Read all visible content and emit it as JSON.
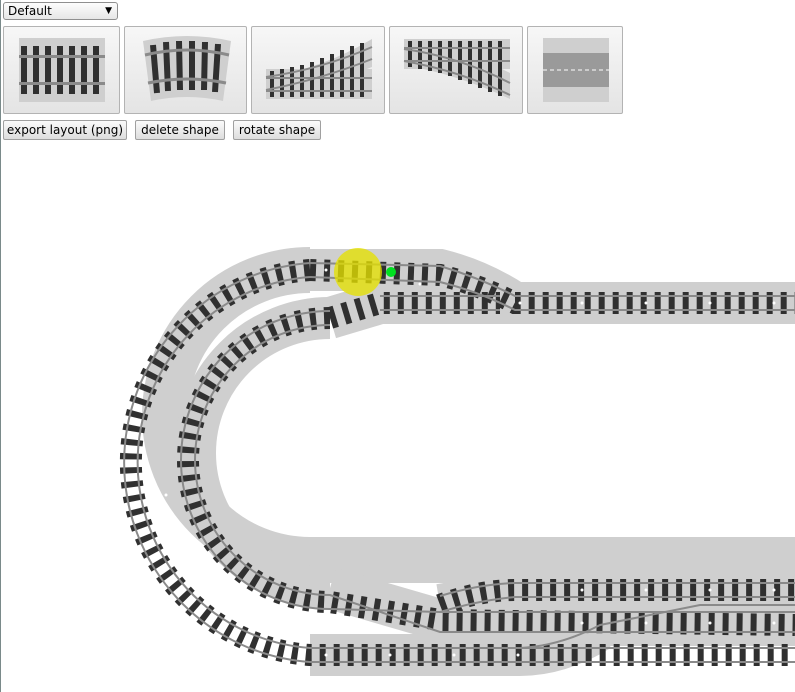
{
  "toolbar": {
    "layout_select": {
      "selected": "Default"
    },
    "shapes": [
      {
        "name": "straight-track-shape"
      },
      {
        "name": "curved-track-shape"
      },
      {
        "name": "right-switch-shape"
      },
      {
        "name": "left-switch-shape"
      },
      {
        "name": "road-shape"
      }
    ],
    "export_label": "export layout (png)",
    "delete_label": "delete shape",
    "rotate_label": "rotate shape"
  },
  "canvas": {
    "colors": {
      "ballast": "#cfcfcf",
      "sleeper": "#303030",
      "rail": "#8a8a8a",
      "highlight": "#e4e000",
      "connector": "#00e020"
    }
  }
}
